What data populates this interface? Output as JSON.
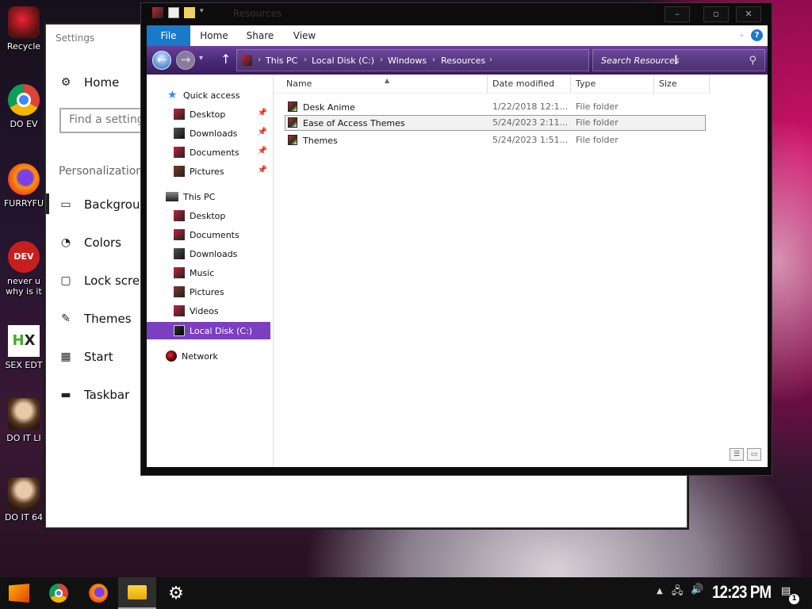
{
  "desktop": {
    "icons": [
      {
        "label": "Recycle"
      },
      {
        "label": "DO EV"
      },
      {
        "label": "FURRYFU"
      },
      {
        "label": "never u",
        "label2": "why is it"
      },
      {
        "label": "SEX EDT"
      },
      {
        "label": "DO IT LI"
      },
      {
        "label": "DO IT 64"
      }
    ]
  },
  "settings": {
    "title": "Settings",
    "home_label": "Home",
    "search_placeholder": "Find a setting",
    "section_label": "Personalization",
    "items": [
      {
        "label": "Background",
        "icon": "image-icon",
        "active": true
      },
      {
        "label": "Colors",
        "icon": "palette-icon"
      },
      {
        "label": "Lock screen",
        "icon": "lock-screen-icon"
      },
      {
        "label": "Themes",
        "icon": "brush-icon"
      },
      {
        "label": "Start",
        "icon": "start-icon"
      },
      {
        "label": "Taskbar",
        "icon": "taskbar-icon"
      }
    ]
  },
  "explorer": {
    "title": "Resources",
    "window_buttons": {
      "minimize": "–",
      "maximize": "▫",
      "close": "✕"
    },
    "ribbon_tabs": [
      "File",
      "Home",
      "Share",
      "View"
    ],
    "breadcrumb": [
      "This PC",
      "Local Disk (C:)",
      "Windows",
      "Resources"
    ],
    "search_placeholder": "Search Resources",
    "nav": {
      "quick_access": "Quick access",
      "quick_items": [
        "Desktop",
        "Downloads",
        "Documents",
        "Pictures"
      ],
      "this_pc": "This PC",
      "pc_items": [
        "Desktop",
        "Documents",
        "Downloads",
        "Music",
        "Pictures",
        "Videos",
        "Local Disk (C:)"
      ],
      "selected": "Local Disk (C:)",
      "network": "Network"
    },
    "columns": [
      "Name",
      "Date modified",
      "Type",
      "Size"
    ],
    "files": [
      {
        "name": "Desk Anime",
        "date": "1/22/2018 12:1...",
        "type": "File folder",
        "size": ""
      },
      {
        "name": "Ease of Access Themes",
        "date": "5/24/2023 2:11...",
        "type": "File folder",
        "size": "",
        "selected": true
      },
      {
        "name": "Themes",
        "date": "5/24/2023 1:51...",
        "type": "File folder",
        "size": ""
      }
    ]
  },
  "taskbar": {
    "apps": [
      "start-icon",
      "chrome-icon",
      "firefox-icon",
      "file-explorer-icon",
      "settings-gear-icon"
    ],
    "active_app": "file-explorer-icon",
    "clock": "12:23 PM",
    "notification_count": "1"
  }
}
